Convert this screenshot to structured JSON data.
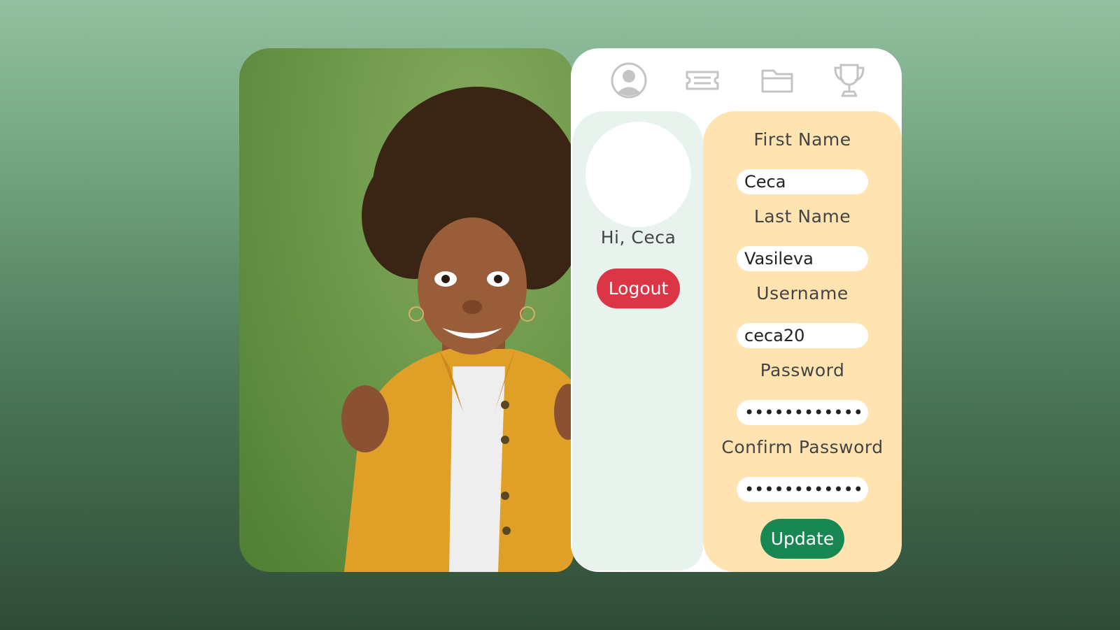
{
  "nav": {
    "icons": [
      "user-circle-icon",
      "ticket-icon",
      "folder-icon",
      "trophy-icon"
    ],
    "icon_color": "#c4c4c4"
  },
  "sidebar": {
    "greeting": "Hi, Ceca",
    "logout_label": "Logout"
  },
  "form": {
    "first_name_label": "First Name",
    "first_name_value": "Ceca",
    "last_name_label": "Last Name",
    "last_name_value": "Vasileva",
    "username_label": "Username",
    "username_value": "ceca20",
    "password_label": "Password",
    "password_value": "•••••••••••••••",
    "confirm_password_label": "Confirm Password",
    "confirm_password_value": "•••••••••••••••",
    "update_label": "Update"
  },
  "colors": {
    "logout": "#dc3545",
    "update": "#198754",
    "form_panel": "#ffe4b2",
    "side_panel": "#e9f3ee"
  }
}
